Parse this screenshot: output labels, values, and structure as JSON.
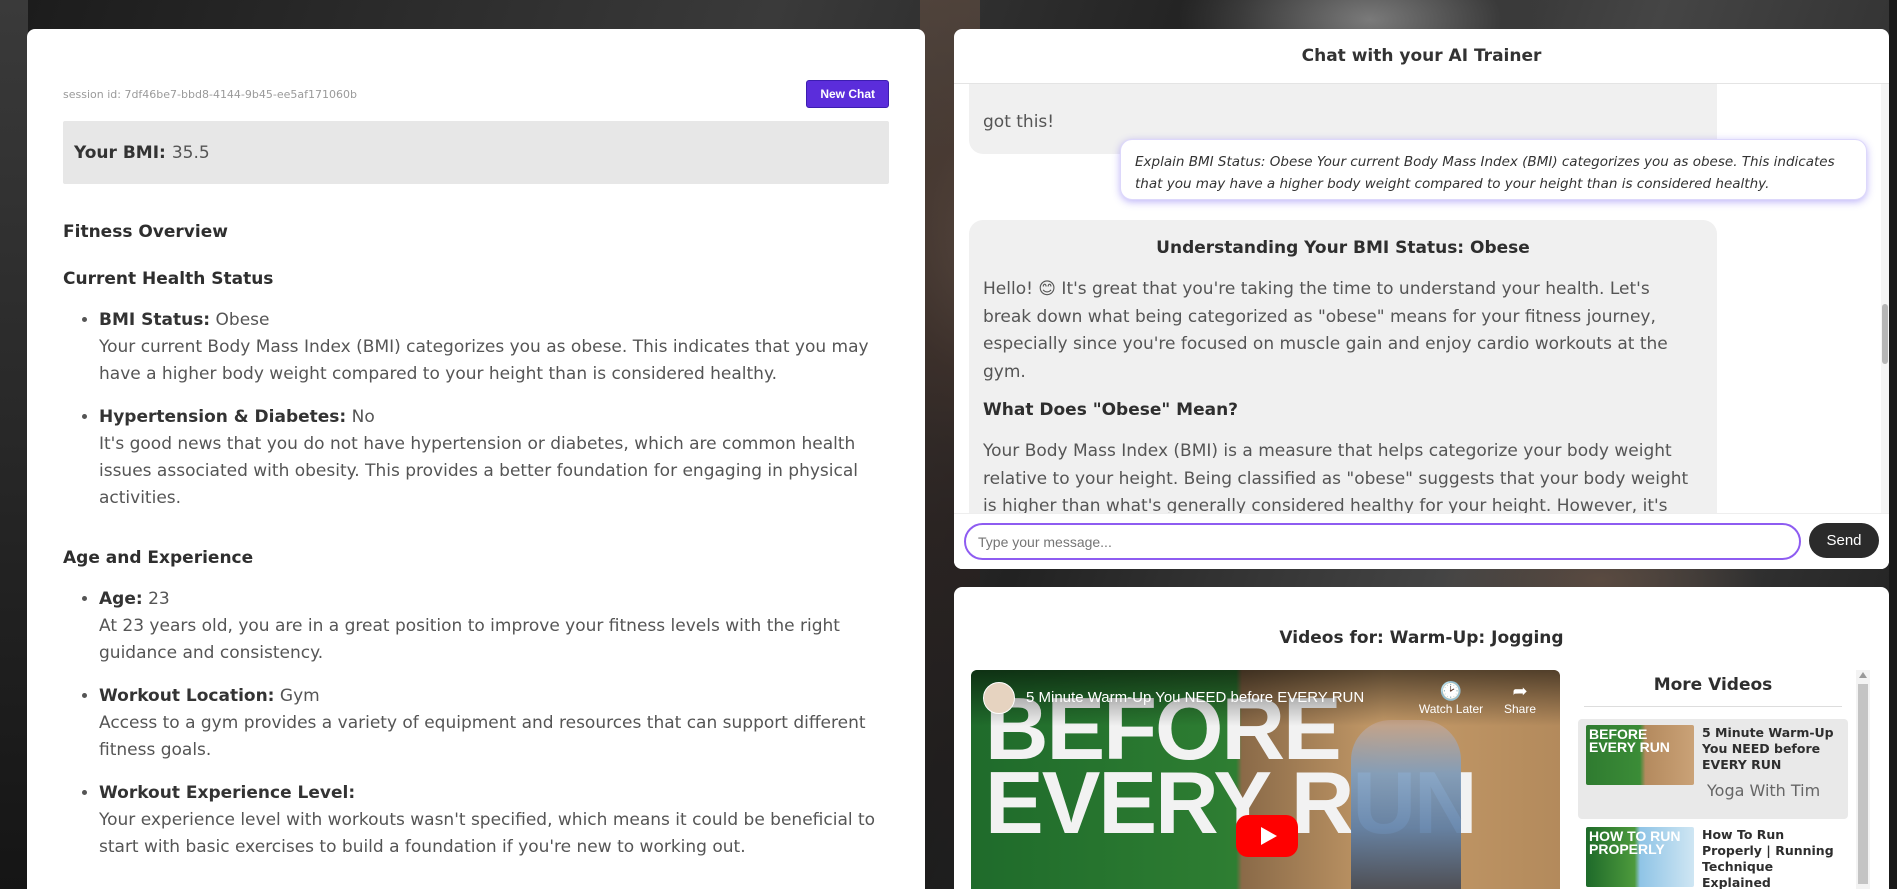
{
  "session": {
    "id_text": "session id: 7df46be7-bbd8-4144-9b45-ee5af171060b",
    "new_chat_label": "New Chat"
  },
  "bmi": {
    "label": "Your BMI:",
    "value": "35.5"
  },
  "overview": {
    "title": "Fitness Overview",
    "current_health_title": "Current Health Status",
    "health_items": [
      {
        "label": "BMI Status:",
        "value": "Obese",
        "desc": "Your current Body Mass Index (BMI) categorizes you as obese. This indicates that you may have a higher body weight compared to your height than is considered healthy."
      },
      {
        "label": "Hypertension & Diabetes:",
        "value": "No",
        "desc": "It's good news that you do not have hypertension or diabetes, which are common health issues associated with obesity. This provides a better foundation for engaging in physical activities."
      }
    ],
    "age_title": "Age and Experience",
    "age_items": [
      {
        "label": "Age:",
        "value": "23",
        "desc": "At 23 years old, you are in a great position to improve your fitness levels with the right guidance and consistency."
      },
      {
        "label": "Workout Location:",
        "value": "Gym",
        "desc": "Access to a gym provides a variety of equipment and resources that can support different fitness goals."
      },
      {
        "label": "Workout Experience Level:",
        "value": "",
        "desc": "Your experience level with workouts wasn't specified, which means it could be beneficial to start with basic exercises to build a foundation if you're new to working out."
      }
    ]
  },
  "chat": {
    "title": "Chat with your AI Trainer",
    "prev_ai_tail": "got this!",
    "user_message": "Explain BMI Status: Obese Your current Body Mass Index (BMI) categorizes you as obese. This indicates that you may have a higher body weight compared to your height than is considered healthy.",
    "ai_title": "Understanding Your BMI Status: Obese",
    "ai_p1": "Hello! 😊 It's great that you're taking the time to understand your health. Let's break down what being categorized as \"obese\" means for your fitness journey, especially since you're focused on muscle gain and enjoy cardio workouts at the gym.",
    "ai_h2": "What Does \"Obese\" Mean?",
    "ai_p2": "Your Body Mass Index (BMI) is a measure that helps categorize your body weight relative to your height. Being classified as \"obese\" suggests that your body weight is higher than what's generally considered healthy for your height. However, it's",
    "input_placeholder": "Type your message...",
    "send_label": "Send"
  },
  "videos": {
    "title": "Videos for: Warm-Up: Jogging",
    "player": {
      "video_title": "5 Minute Warm-Up You NEED before EVERY RUN",
      "thumbnail_text": "BEFORE EVERY RUN",
      "watch_later_label": "Watch Later",
      "share_label": "Share"
    },
    "more_title": "More Videos",
    "items": [
      {
        "title": "5 Minute Warm-Up You NEED before EVERY RUN",
        "channel": "Yoga With Tim",
        "thumb_text": "BEFORE EVERY RUN"
      },
      {
        "title": "How To Run Properly | Running Technique Explained",
        "channel": "",
        "thumb_text": "HOW TO RUN PROPERLY"
      }
    ]
  }
}
